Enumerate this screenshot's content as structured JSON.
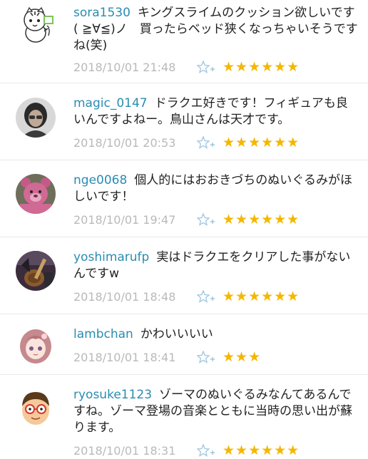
{
  "comments": [
    {
      "username": "sora1530",
      "text": "キングスライムのクッション欲しいです( ≧∀≦)ノ　買ったらベッド狭くなっちゃいそうですね(笑)",
      "date": "2018/10/01 21:48",
      "stars": "★★★★★★",
      "star_count": 6,
      "avatar_icon": "tiger-character-avatar"
    },
    {
      "username": "magic_0147",
      "text": "ドラクエ好きです！フィギュアも良いんですよねー。鳥山さんは天才です。",
      "date": "2018/10/01 20:53",
      "stars": "★★★★★★",
      "star_count": 6,
      "avatar_icon": "person-photo-avatar"
    },
    {
      "username": "nge0068",
      "text": "個人的にはおおきづちのぬいぐるみがほしいです！",
      "date": "2018/10/01 19:47",
      "stars": "★★★★★★",
      "star_count": 6,
      "avatar_icon": "pink-bear-avatar"
    },
    {
      "username": "yoshimarufp",
      "text": "実はドラクエをクリアした事がないんですw",
      "date": "2018/10/01 18:48",
      "stars": "★★★★★★",
      "star_count": 6,
      "avatar_icon": "guitar-photo-avatar"
    },
    {
      "username": "lambchan",
      "text": "かわいいいい",
      "date": "2018/10/01 18:41",
      "stars": "★★★",
      "star_count": 3,
      "avatar_icon": "anime-girl-avatar"
    },
    {
      "username": "ryosuke1123",
      "text": "ゾーマのぬいぐるみなんてあるんですね。ゾーマ登場の音楽とともに当時の思い出が蘇ります。",
      "date": "2018/10/01 18:31",
      "stars": "★★★★★★",
      "star_count": 6,
      "avatar_icon": "glasses-boy-avatar"
    }
  ],
  "colors": {
    "username": "#2a8cb3",
    "text": "#222222",
    "date": "#b9b9b9",
    "star": "#f4b700",
    "fav_icon": "#9ec6e0"
  }
}
